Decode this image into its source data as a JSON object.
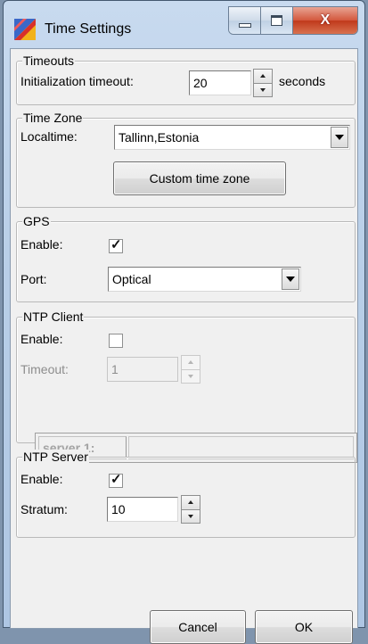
{
  "window": {
    "title": "Time Settings",
    "app_icon": "colored-flag-icon",
    "close_glyph": "X",
    "accent": "#c0391b"
  },
  "timeouts": {
    "legend": "Timeouts",
    "init_label": "Initialization timeout:",
    "init_value": "20",
    "unit": "seconds"
  },
  "timezone": {
    "legend": "Time Zone",
    "label": "Localtime:",
    "value": "Tallinn,Estonia",
    "custom_button": "Custom time zone"
  },
  "gps": {
    "legend": "GPS",
    "enable_label": "Enable:",
    "enabled": true,
    "port_label": "Port:",
    "port_value": "Optical"
  },
  "ntp_client": {
    "legend": "NTP Client",
    "enable_label": "Enable:",
    "enabled": false,
    "timeout_label": "Timeout:",
    "timeout_value": "1",
    "server_label": "server 1:",
    "server_value": ""
  },
  "ntp_server": {
    "legend": "NTP Server",
    "enable_label": "Enable:",
    "enabled": true,
    "stratum_label": "Stratum:",
    "stratum_value": "10"
  },
  "buttons": {
    "cancel": "Cancel",
    "ok": "OK"
  },
  "check_glyph": "✓"
}
